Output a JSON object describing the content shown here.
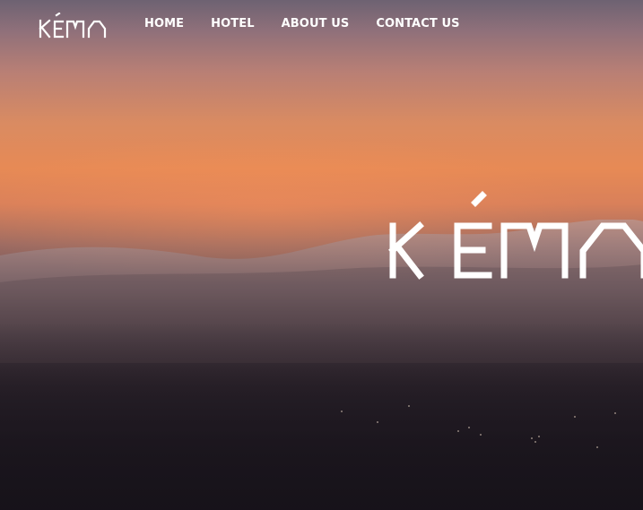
{
  "brand": {
    "logo_text": "KÉMA",
    "hero_logo_text": "KÉMA"
  },
  "nav": {
    "items": [
      {
        "label": "HOME"
      },
      {
        "label": "HOTEL"
      },
      {
        "label": "ABOUT US"
      },
      {
        "label": "CONTACT US"
      }
    ]
  },
  "colors": {
    "nav_text": "#ffffff",
    "sky_top": "#6d6272",
    "sky_orange": "#e78a55",
    "ground_dark": "#1d171f"
  },
  "hero": {
    "background": "sunset-over-clouds-image"
  }
}
